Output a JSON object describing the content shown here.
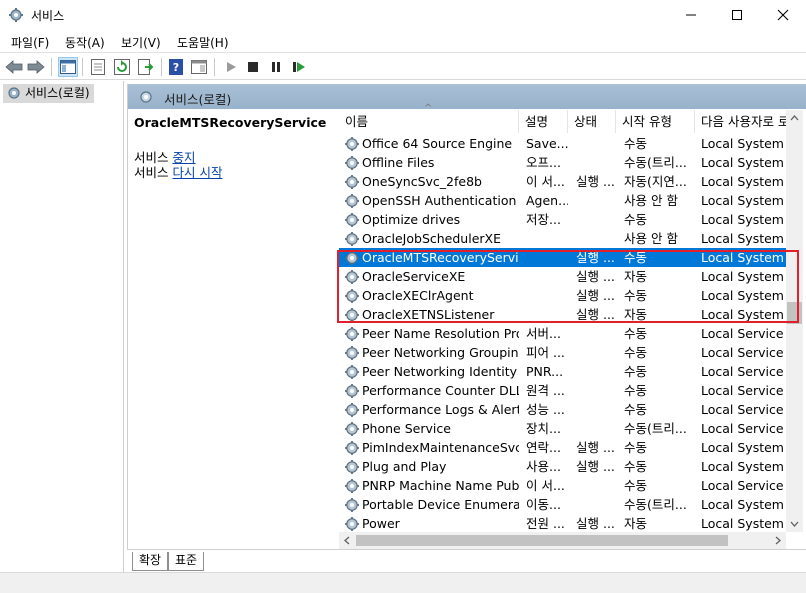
{
  "window": {
    "title": "서비스"
  },
  "menu": [
    "파일(F)",
    "동작(A)",
    "보기(V)",
    "도움말(H)"
  ],
  "toolbar": {
    "icons": [
      "back-arrow-icon",
      "forward-arrow-icon",
      "console-tree-icon",
      "properties-icon",
      "refresh-icon",
      "export-list-icon",
      "help-icon",
      "show-action-pane-icon",
      "start-service-icon",
      "stop-service-icon",
      "pause-service-icon",
      "restart-service-icon"
    ]
  },
  "tree": {
    "root_label": "서비스(로컬)"
  },
  "content": {
    "header_label": "서비스(로컬)",
    "selected_service": "OracleMTSRecoveryService",
    "action_stop_prefix": "서비스 ",
    "action_stop_link": "중지",
    "action_restart_prefix": "서비스 ",
    "action_restart_link": "다시 시작"
  },
  "list": {
    "columns": [
      "이름",
      "설명",
      "상태",
      "시작 유형",
      "다음 사용자로 로그온"
    ],
    "rows": [
      {
        "name": "Office 64 Source Engine",
        "desc": "Save...",
        "status": "",
        "startup": "수동",
        "logon": "Local System"
      },
      {
        "name": "Offline Files",
        "desc": "오프...",
        "status": "",
        "startup": "수동(트리...",
        "logon": "Local System"
      },
      {
        "name": "OneSyncSvc_2fe8b",
        "desc": "이 서...",
        "status": "실행 ...",
        "startup": "자동(지연...",
        "logon": "Local System"
      },
      {
        "name": "OpenSSH Authentication A...",
        "desc": "Agen...",
        "status": "",
        "startup": "사용 안 함",
        "logon": "Local System"
      },
      {
        "name": "Optimize drives",
        "desc": "저장...",
        "status": "",
        "startup": "수동",
        "logon": "Local System"
      },
      {
        "name": "OracleJobSchedulerXE",
        "desc": "",
        "status": "",
        "startup": "사용 안 함",
        "logon": "Local System"
      },
      {
        "name": "OracleMTSRecoveryService",
        "desc": "",
        "status": "실행 ...",
        "startup": "수동",
        "logon": "Local System",
        "selected": true
      },
      {
        "name": "OracleServiceXE",
        "desc": "",
        "status": "실행 ...",
        "startup": "자동",
        "logon": "Local System"
      },
      {
        "name": "OracleXEClrAgent",
        "desc": "",
        "status": "실행 ...",
        "startup": "수동",
        "logon": "Local System"
      },
      {
        "name": "OracleXETNSListener",
        "desc": "",
        "status": "실행 ...",
        "startup": "자동",
        "logon": "Local System"
      },
      {
        "name": "Peer Name Resolution Prot...",
        "desc": "서버...",
        "status": "",
        "startup": "수동",
        "logon": "Local Service"
      },
      {
        "name": "Peer Networking Grouping",
        "desc": "피어 ...",
        "status": "",
        "startup": "수동",
        "logon": "Local Service"
      },
      {
        "name": "Peer Networking Identity ...",
        "desc": "PNR...",
        "status": "",
        "startup": "수동",
        "logon": "Local Service"
      },
      {
        "name": "Performance Counter DLL ...",
        "desc": "원격 ...",
        "status": "",
        "startup": "수동",
        "logon": "Local Service"
      },
      {
        "name": "Performance Logs & Alerts",
        "desc": "성능 ...",
        "status": "",
        "startup": "수동",
        "logon": "Local Service"
      },
      {
        "name": "Phone Service",
        "desc": "장치...",
        "status": "",
        "startup": "수동(트리...",
        "logon": "Local Service"
      },
      {
        "name": "PimIndexMaintenanceSvc_...",
        "desc": "연락...",
        "status": "실행 ...",
        "startup": "수동",
        "logon": "Local System"
      },
      {
        "name": "Plug and Play",
        "desc": "사용...",
        "status": "실행 ...",
        "startup": "수동",
        "logon": "Local System"
      },
      {
        "name": "PNRP Machine Name Publi...",
        "desc": "이 서...",
        "status": "",
        "startup": "수동",
        "logon": "Local Service"
      },
      {
        "name": "Portable Device Enumerato...",
        "desc": "이동...",
        "status": "",
        "startup": "수동(트리...",
        "logon": "Local System"
      },
      {
        "name": "Power",
        "desc": "전원 ...",
        "status": "실행 ...",
        "startup": "자동",
        "logon": "Local System"
      }
    ]
  },
  "tabs": [
    "확장",
    "표준"
  ],
  "colors": {
    "selection": "#0078d7",
    "highlight_box": "#e2202b",
    "header_band": "#a9c0d6"
  }
}
